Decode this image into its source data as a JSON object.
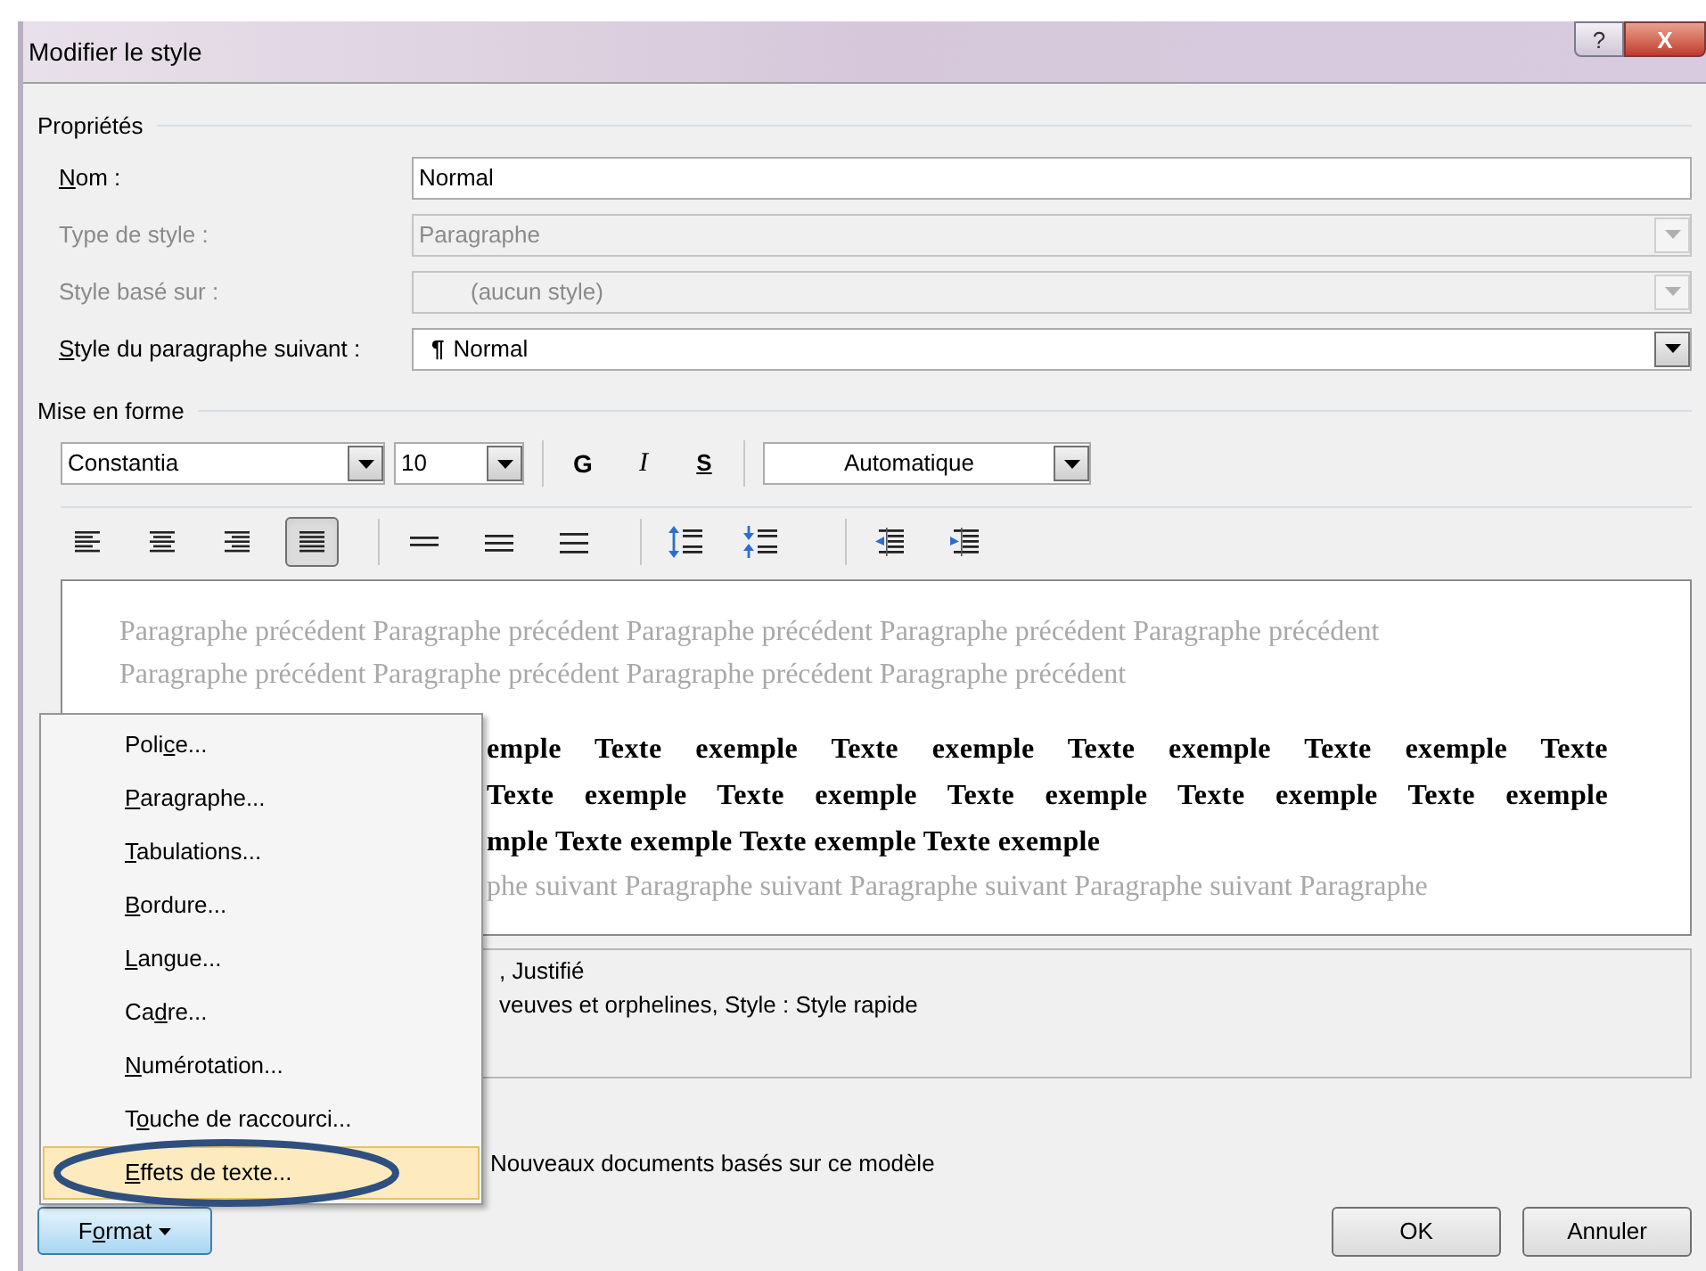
{
  "window": {
    "title": "Modifier le style",
    "buttons": [
      {
        "kind": "help",
        "label": "?"
      },
      {
        "kind": "close",
        "label": "X"
      }
    ]
  },
  "properties": {
    "title": "Propriétés",
    "rows": [
      {
        "label": {
          "key": "N",
          "post": "om :"
        },
        "value": "Normal",
        "kind": "text",
        "disabled": false
      },
      {
        "label": {
          "pre": "Type de style :"
        },
        "value": "Paragraphe",
        "kind": "dropdown",
        "disabled": true
      },
      {
        "label": {
          "pre": "Style basé sur :"
        },
        "value": "(aucun style)",
        "kind": "dropdown",
        "disabled": true,
        "indented": true
      },
      {
        "label": {
          "key": "S",
          "post": "tyle du paragraphe suivant :"
        },
        "value": "Normal",
        "pilcrow": "¶",
        "kind": "dropdown",
        "disabled": false
      }
    ]
  },
  "formatting": {
    "title": "Mise en forme",
    "font": "Constantia",
    "size": "10",
    "bold": "G",
    "italic": "I",
    "underline": "S",
    "font_color": "Automatique",
    "alignment_buttons": [
      {
        "kind": "left",
        "selected": false
      },
      {
        "kind": "center",
        "selected": false
      },
      {
        "kind": "right",
        "selected": false
      },
      {
        "kind": "justify",
        "selected": true
      }
    ],
    "spacing_buttons": [
      {
        "kind": "single"
      },
      {
        "kind": "one-half"
      },
      {
        "kind": "double"
      }
    ],
    "paragraph_spacing_buttons": [
      {
        "kind": "increase"
      },
      {
        "kind": "decrease"
      }
    ],
    "indent_buttons": [
      {
        "kind": "decrease"
      },
      {
        "kind": "increase"
      }
    ]
  },
  "preview": {
    "previous_lines": [
      "Paragraphe précédent Paragraphe précédent Paragraphe précédent Paragraphe précédent Paragraphe précédent",
      "Paragraphe précédent Paragraphe précédent Paragraphe précédent Paragraphe précédent"
    ],
    "sample_lines": [
      "emple Texte exemple Texte exemple Texte exemple Texte exemple Texte",
      "Texte exemple Texte exemple Texte exemple Texte exemple Texte exemple",
      "mple Texte exemple Texte exemple Texte exemple"
    ],
    "next_lines": [
      "phe suivant Paragraphe suivant Paragraphe suivant Paragraphe suivant Paragraphe"
    ]
  },
  "description": {
    "lines": [
      ", Justifié",
      "veuves et orphelines, Style : Style rapide"
    ]
  },
  "new_documents_option": {
    "label": "Nouveaux documents basés sur ce modèle"
  },
  "format_button": {
    "pre": "F",
    "key": "o",
    "post": "rmat"
  },
  "buttons": [
    "OK",
    "Annuler"
  ],
  "format_menu": {
    "items": [
      {
        "pre": "Poli",
        "key": "c",
        "post": "e...",
        "selected": false
      },
      {
        "key": "P",
        "post": "aragraphe...",
        "selected": false
      },
      {
        "key": "T",
        "post": "abulations...",
        "selected": false
      },
      {
        "key": "B",
        "post": "ordure...",
        "selected": false
      },
      {
        "key": "L",
        "post": "angue...",
        "selected": false
      },
      {
        "pre": "Ca",
        "key": "d",
        "post": "re...",
        "selected": false
      },
      {
        "key": "N",
        "post": "umérotation...",
        "selected": false
      },
      {
        "pre": "T",
        "key": "o",
        "post": "uche de raccourci...",
        "selected": false
      },
      {
        "key": "E",
        "post": "ffets de texte...",
        "selected": true
      }
    ]
  }
}
